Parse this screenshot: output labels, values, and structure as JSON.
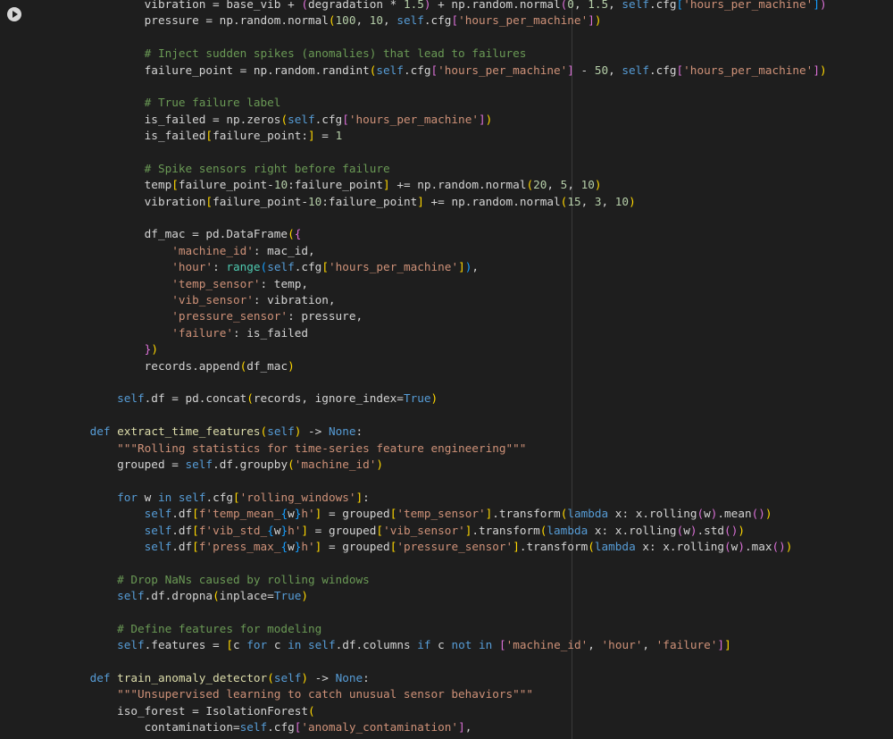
{
  "colors": {
    "background": "#1e1e1e",
    "plain": "#d4d4d4",
    "keyword": "#569cd6",
    "string": "#ce9178",
    "comment": "#6a9955",
    "number": "#b5cea8",
    "function": "#dcdcaa",
    "builtin": "#4ec9b0",
    "param": "#9cdcfe",
    "bracket": "#ffd700",
    "bracket2": "#da70d6",
    "bracket3": "#179fff"
  },
  "run_button": {
    "icon": "play-circle-icon"
  },
  "lines": [
    [
      [
        "plain",
        "            vibration = base_vib + "
      ],
      [
        "bracket2",
        "("
      ],
      [
        "plain",
        "degradation * "
      ],
      [
        "num",
        "1.5"
      ],
      [
        "bracket2",
        ")"
      ],
      [
        "plain",
        " + np.random.normal"
      ],
      [
        "bracket2",
        "("
      ],
      [
        "num",
        "0"
      ],
      [
        "plain",
        ", "
      ],
      [
        "num",
        "1.5"
      ],
      [
        "plain",
        ", "
      ],
      [
        "selfv",
        "self"
      ],
      [
        "plain",
        ".cfg"
      ],
      [
        "bracket3",
        "["
      ],
      [
        "str",
        "'hours_per_machine'"
      ],
      [
        "bracket3",
        "]"
      ],
      [
        "bracket2",
        ")"
      ]
    ],
    [
      [
        "plain",
        "            pressure = np.random.normal"
      ],
      [
        "bracket",
        "("
      ],
      [
        "num",
        "100"
      ],
      [
        "plain",
        ", "
      ],
      [
        "num",
        "10"
      ],
      [
        "plain",
        ", "
      ],
      [
        "selfv",
        "self"
      ],
      [
        "plain",
        ".cfg"
      ],
      [
        "bracket2",
        "["
      ],
      [
        "str",
        "'hours_per_machine'"
      ],
      [
        "bracket2",
        "]"
      ],
      [
        "bracket",
        ")"
      ]
    ],
    [
      [
        "plain",
        ""
      ]
    ],
    [
      [
        "comment",
        "            # Inject sudden spikes (anomalies) that lead to failures"
      ]
    ],
    [
      [
        "plain",
        "            failure_point = np.random.randint"
      ],
      [
        "bracket",
        "("
      ],
      [
        "selfv",
        "self"
      ],
      [
        "plain",
        ".cfg"
      ],
      [
        "bracket2",
        "["
      ],
      [
        "str",
        "'hours_per_machine'"
      ],
      [
        "bracket2",
        "]"
      ],
      [
        "plain",
        " - "
      ],
      [
        "num",
        "50"
      ],
      [
        "plain",
        ", "
      ],
      [
        "selfv",
        "self"
      ],
      [
        "plain",
        ".cfg"
      ],
      [
        "bracket2",
        "["
      ],
      [
        "str",
        "'hours_per_machine'"
      ],
      [
        "bracket2",
        "]"
      ],
      [
        "bracket",
        ")"
      ]
    ],
    [
      [
        "plain",
        ""
      ]
    ],
    [
      [
        "comment",
        "            # True failure label"
      ]
    ],
    [
      [
        "plain",
        "            is_failed = np.zeros"
      ],
      [
        "bracket",
        "("
      ],
      [
        "selfv",
        "self"
      ],
      [
        "plain",
        ".cfg"
      ],
      [
        "bracket2",
        "["
      ],
      [
        "str",
        "'hours_per_machine'"
      ],
      [
        "bracket2",
        "]"
      ],
      [
        "bracket",
        ")"
      ]
    ],
    [
      [
        "plain",
        "            is_failed"
      ],
      [
        "bracket",
        "["
      ],
      [
        "plain",
        "failure_point:"
      ],
      [
        "bracket",
        "]"
      ],
      [
        "plain",
        " = "
      ],
      [
        "num",
        "1"
      ]
    ],
    [
      [
        "plain",
        ""
      ]
    ],
    [
      [
        "comment",
        "            # Spike sensors right before failure"
      ]
    ],
    [
      [
        "plain",
        "            temp"
      ],
      [
        "bracket",
        "["
      ],
      [
        "plain",
        "failure_point-"
      ],
      [
        "num",
        "10"
      ],
      [
        "plain",
        ":failure_point"
      ],
      [
        "bracket",
        "]"
      ],
      [
        "plain",
        " += np.random.normal"
      ],
      [
        "bracket",
        "("
      ],
      [
        "num",
        "20"
      ],
      [
        "plain",
        ", "
      ],
      [
        "num",
        "5"
      ],
      [
        "plain",
        ", "
      ],
      [
        "num",
        "10"
      ],
      [
        "bracket",
        ")"
      ]
    ],
    [
      [
        "plain",
        "            vibration"
      ],
      [
        "bracket",
        "["
      ],
      [
        "plain",
        "failure_point-"
      ],
      [
        "num",
        "10"
      ],
      [
        "plain",
        ":failure_point"
      ],
      [
        "bracket",
        "]"
      ],
      [
        "plain",
        " += np.random.normal"
      ],
      [
        "bracket",
        "("
      ],
      [
        "num",
        "15"
      ],
      [
        "plain",
        ", "
      ],
      [
        "num",
        "3"
      ],
      [
        "plain",
        ", "
      ],
      [
        "num",
        "10"
      ],
      [
        "bracket",
        ")"
      ]
    ],
    [
      [
        "plain",
        ""
      ]
    ],
    [
      [
        "plain",
        "            df_mac = pd.DataFrame"
      ],
      [
        "bracket",
        "("
      ],
      [
        "bracket2",
        "{"
      ]
    ],
    [
      [
        "plain",
        "                "
      ],
      [
        "str",
        "'machine_id'"
      ],
      [
        "plain",
        ": mac_id,"
      ]
    ],
    [
      [
        "plain",
        "                "
      ],
      [
        "str",
        "'hour'"
      ],
      [
        "plain",
        ": "
      ],
      [
        "builtin",
        "range"
      ],
      [
        "bracket3",
        "("
      ],
      [
        "selfv",
        "self"
      ],
      [
        "plain",
        ".cfg"
      ],
      [
        "bracket",
        "["
      ],
      [
        "str",
        "'hours_per_machine'"
      ],
      [
        "bracket",
        "]"
      ],
      [
        "bracket3",
        ")"
      ],
      [
        "plain",
        ","
      ]
    ],
    [
      [
        "plain",
        "                "
      ],
      [
        "str",
        "'temp_sensor'"
      ],
      [
        "plain",
        ": temp,"
      ]
    ],
    [
      [
        "plain",
        "                "
      ],
      [
        "str",
        "'vib_sensor'"
      ],
      [
        "plain",
        ": vibration,"
      ]
    ],
    [
      [
        "plain",
        "                "
      ],
      [
        "str",
        "'pressure_sensor'"
      ],
      [
        "plain",
        ": pressure,"
      ]
    ],
    [
      [
        "plain",
        "                "
      ],
      [
        "str",
        "'failure'"
      ],
      [
        "plain",
        ": is_failed"
      ]
    ],
    [
      [
        "plain",
        "            "
      ],
      [
        "bracket2",
        "}"
      ],
      [
        "bracket",
        ")"
      ]
    ],
    [
      [
        "plain",
        "            records.append"
      ],
      [
        "bracket",
        "("
      ],
      [
        "plain",
        "df_mac"
      ],
      [
        "bracket",
        ")"
      ]
    ],
    [
      [
        "plain",
        ""
      ]
    ],
    [
      [
        "plain",
        "        "
      ],
      [
        "selfv",
        "self"
      ],
      [
        "plain",
        ".df = pd.concat"
      ],
      [
        "bracket",
        "("
      ],
      [
        "plain",
        "records, ignore_index="
      ],
      [
        "kw",
        "True"
      ],
      [
        "bracket",
        ")"
      ]
    ],
    [
      [
        "plain",
        ""
      ]
    ],
    [
      [
        "plain",
        "    "
      ],
      [
        "kw",
        "def"
      ],
      [
        "plain",
        " "
      ],
      [
        "fn",
        "extract_time_features"
      ],
      [
        "bracket",
        "("
      ],
      [
        "selfv",
        "self"
      ],
      [
        "bracket",
        ")"
      ],
      [
        "plain",
        " -> "
      ],
      [
        "kw",
        "None"
      ],
      [
        "plain",
        ":"
      ]
    ],
    [
      [
        "str",
        "        \"\"\"Rolling statistics for time-series feature engineering\"\"\""
      ]
    ],
    [
      [
        "plain",
        "        grouped = "
      ],
      [
        "selfv",
        "self"
      ],
      [
        "plain",
        ".df.groupby"
      ],
      [
        "bracket",
        "("
      ],
      [
        "str",
        "'machine_id'"
      ],
      [
        "bracket",
        ")"
      ]
    ],
    [
      [
        "plain",
        ""
      ]
    ],
    [
      [
        "plain",
        "        "
      ],
      [
        "kw",
        "for"
      ],
      [
        "plain",
        " w "
      ],
      [
        "kw",
        "in"
      ],
      [
        "plain",
        " "
      ],
      [
        "selfv",
        "self"
      ],
      [
        "plain",
        ".cfg"
      ],
      [
        "bracket",
        "["
      ],
      [
        "str",
        "'rolling_windows'"
      ],
      [
        "bracket",
        "]"
      ],
      [
        "plain",
        ":"
      ]
    ],
    [
      [
        "plain",
        "            "
      ],
      [
        "selfv",
        "self"
      ],
      [
        "plain",
        ".df"
      ],
      [
        "bracket",
        "["
      ],
      [
        "str",
        "f'temp_mean_"
      ],
      [
        "bracket3",
        "{"
      ],
      [
        "plain",
        "w"
      ],
      [
        "bracket3",
        "}"
      ],
      [
        "str",
        "h'"
      ],
      [
        "bracket",
        "]"
      ],
      [
        "plain",
        " = grouped"
      ],
      [
        "bracket",
        "["
      ],
      [
        "str",
        "'temp_sensor'"
      ],
      [
        "bracket",
        "]"
      ],
      [
        "plain",
        ".transform"
      ],
      [
        "bracket",
        "("
      ],
      [
        "kw",
        "lambda"
      ],
      [
        "plain",
        " x: x.rolling"
      ],
      [
        "bracket2",
        "("
      ],
      [
        "plain",
        "w"
      ],
      [
        "bracket2",
        ")"
      ],
      [
        "plain",
        ".mean"
      ],
      [
        "bracket2",
        "("
      ],
      [
        "bracket2",
        ")"
      ],
      [
        "bracket",
        ")"
      ]
    ],
    [
      [
        "plain",
        "            "
      ],
      [
        "selfv",
        "self"
      ],
      [
        "plain",
        ".df"
      ],
      [
        "bracket",
        "["
      ],
      [
        "str",
        "f'vib_std_"
      ],
      [
        "bracket3",
        "{"
      ],
      [
        "plain",
        "w"
      ],
      [
        "bracket3",
        "}"
      ],
      [
        "str",
        "h'"
      ],
      [
        "bracket",
        "]"
      ],
      [
        "plain",
        " = grouped"
      ],
      [
        "bracket",
        "["
      ],
      [
        "str",
        "'vib_sensor'"
      ],
      [
        "bracket",
        "]"
      ],
      [
        "plain",
        ".transform"
      ],
      [
        "bracket",
        "("
      ],
      [
        "kw",
        "lambda"
      ],
      [
        "plain",
        " x: x.rolling"
      ],
      [
        "bracket2",
        "("
      ],
      [
        "plain",
        "w"
      ],
      [
        "bracket2",
        ")"
      ],
      [
        "plain",
        ".std"
      ],
      [
        "bracket2",
        "("
      ],
      [
        "bracket2",
        ")"
      ],
      [
        "bracket",
        ")"
      ]
    ],
    [
      [
        "plain",
        "            "
      ],
      [
        "selfv",
        "self"
      ],
      [
        "plain",
        ".df"
      ],
      [
        "bracket",
        "["
      ],
      [
        "str",
        "f'press_max_"
      ],
      [
        "bracket3",
        "{"
      ],
      [
        "plain",
        "w"
      ],
      [
        "bracket3",
        "}"
      ],
      [
        "str",
        "h'"
      ],
      [
        "bracket",
        "]"
      ],
      [
        "plain",
        " = grouped"
      ],
      [
        "bracket",
        "["
      ],
      [
        "str",
        "'pressure_sensor'"
      ],
      [
        "bracket",
        "]"
      ],
      [
        "plain",
        ".transform"
      ],
      [
        "bracket",
        "("
      ],
      [
        "kw",
        "lambda"
      ],
      [
        "plain",
        " x: x.rolling"
      ],
      [
        "bracket2",
        "("
      ],
      [
        "plain",
        "w"
      ],
      [
        "bracket2",
        ")"
      ],
      [
        "plain",
        ".max"
      ],
      [
        "bracket2",
        "("
      ],
      [
        "bracket2",
        ")"
      ],
      [
        "bracket",
        ")"
      ]
    ],
    [
      [
        "plain",
        ""
      ]
    ],
    [
      [
        "comment",
        "        # Drop NaNs caused by rolling windows"
      ]
    ],
    [
      [
        "plain",
        "        "
      ],
      [
        "selfv",
        "self"
      ],
      [
        "plain",
        ".df.dropna"
      ],
      [
        "bracket",
        "("
      ],
      [
        "plain",
        "inplace="
      ],
      [
        "kw",
        "True"
      ],
      [
        "bracket",
        ")"
      ]
    ],
    [
      [
        "plain",
        ""
      ]
    ],
    [
      [
        "comment",
        "        # Define features for modeling"
      ]
    ],
    [
      [
        "plain",
        "        "
      ],
      [
        "selfv",
        "self"
      ],
      [
        "plain",
        ".features = "
      ],
      [
        "bracket",
        "["
      ],
      [
        "plain",
        "c "
      ],
      [
        "kw",
        "for"
      ],
      [
        "plain",
        " c "
      ],
      [
        "kw",
        "in"
      ],
      [
        "plain",
        " "
      ],
      [
        "selfv",
        "self"
      ],
      [
        "plain",
        ".df.columns "
      ],
      [
        "kw",
        "if"
      ],
      [
        "plain",
        " c "
      ],
      [
        "kw",
        "not"
      ],
      [
        "plain",
        " "
      ],
      [
        "kw",
        "in"
      ],
      [
        "plain",
        " "
      ],
      [
        "bracket2",
        "["
      ],
      [
        "str",
        "'machine_id'"
      ],
      [
        "plain",
        ", "
      ],
      [
        "str",
        "'hour'"
      ],
      [
        "plain",
        ", "
      ],
      [
        "str",
        "'failure'"
      ],
      [
        "bracket2",
        "]"
      ],
      [
        "bracket",
        "]"
      ]
    ],
    [
      [
        "plain",
        ""
      ]
    ],
    [
      [
        "plain",
        "    "
      ],
      [
        "kw",
        "def"
      ],
      [
        "plain",
        " "
      ],
      [
        "fn",
        "train_anomaly_detector"
      ],
      [
        "bracket",
        "("
      ],
      [
        "selfv",
        "self"
      ],
      [
        "bracket",
        ")"
      ],
      [
        "plain",
        " -> "
      ],
      [
        "kw",
        "None"
      ],
      [
        "plain",
        ":"
      ]
    ],
    [
      [
        "str",
        "        \"\"\"Unsupervised learning to catch unusual sensor behaviors\"\"\""
      ]
    ],
    [
      [
        "plain",
        "        iso_forest = IsolationForest"
      ],
      [
        "bracket",
        "("
      ]
    ],
    [
      [
        "plain",
        "            contamination="
      ],
      [
        "selfv",
        "self"
      ],
      [
        "plain",
        ".cfg"
      ],
      [
        "bracket2",
        "["
      ],
      [
        "str",
        "'anomaly_contamination'"
      ],
      [
        "bracket2",
        "]"
      ],
      [
        "plain",
        ","
      ]
    ]
  ]
}
